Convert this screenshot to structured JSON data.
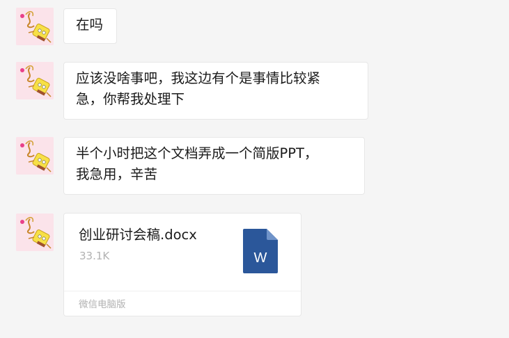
{
  "messages": [
    {
      "text": "在吗"
    },
    {
      "line1": "应该没啥事吧，我这边有个是事情比较紧",
      "line2": "急，你帮我处理下"
    },
    {
      "line1": "半个小时把这个文档弄成一个简版PPT，",
      "line2": "我急用，辛苦"
    }
  ],
  "file": {
    "name": "创业研讨会稿.docx",
    "size": "33.1K",
    "icon": "word-document-icon",
    "icon_letter": "W",
    "icon_color": "#2b579a",
    "source": "微信电脑版"
  },
  "avatar_icon": "spongebob-avatar"
}
